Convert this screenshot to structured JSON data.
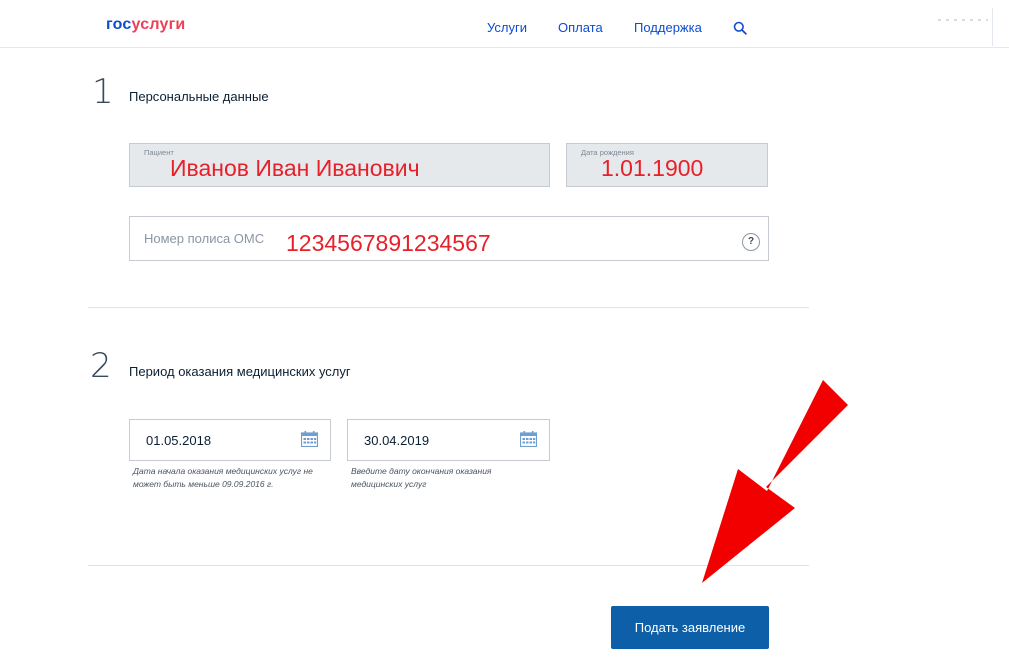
{
  "header": {
    "logo_gos": "гос",
    "logo_uslugi": "услуги",
    "nav": [
      {
        "label": "Услуги"
      },
      {
        "label": "Оплата"
      },
      {
        "label": "Поддержка"
      }
    ],
    "search_icon": "search-icon"
  },
  "section1": {
    "number": "1",
    "title": "Персональные данные",
    "patient": {
      "label": "Пациент",
      "value": "Иванов Иван Иванович"
    },
    "birth": {
      "label": "Дата рождения",
      "value": "1.01.1900"
    },
    "policy": {
      "placeholder": "Номер полиса ОМС",
      "value": "1234567891234567",
      "help": "?"
    }
  },
  "section2": {
    "number": "2",
    "title": "Период оказания медицинских услуг",
    "start": {
      "value": "01.05.2018",
      "hint": "Дата начала оказания медицинских услуг не может быть меньше 09.09.2016 г."
    },
    "end": {
      "value": "30.04.2019",
      "hint": "Введите дату окончания оказания медицинских услуг"
    }
  },
  "submit_label": "Подать заявление",
  "colors": {
    "brand_blue": "#0d4cd3",
    "brand_red": "#ee3f58",
    "annotation_red": "#e8202a",
    "button_blue": "#0d5fa8"
  }
}
